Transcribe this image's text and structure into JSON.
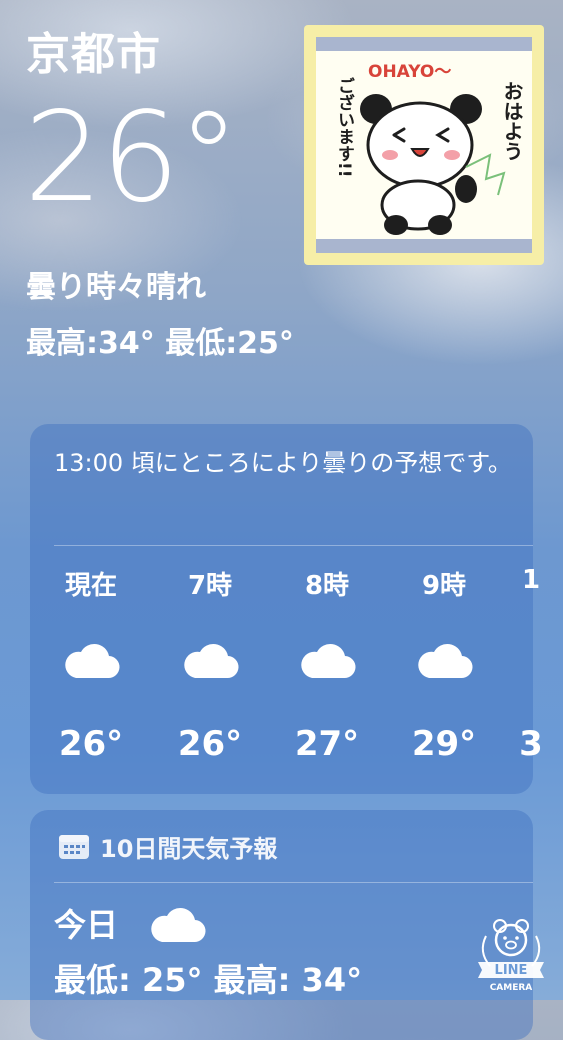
{
  "header": {
    "city": "京都市",
    "temperature": "26°",
    "condition": "曇り時々晴れ",
    "high_low": "最高:34°  最低:25°"
  },
  "sticker": {
    "banner": "OHAYO〜",
    "greeting_line1": "おはよう",
    "greeting_line2": "ございます!!",
    "icon": "panda-sticker-icon"
  },
  "hourly": {
    "summary": "13:00 頃にところにより曇りの予想です。",
    "items": [
      {
        "time": "現在",
        "icon": "cloud-icon",
        "temp": "26°"
      },
      {
        "time": "7時",
        "icon": "cloud-icon",
        "temp": "26°"
      },
      {
        "time": "8時",
        "icon": "cloud-icon",
        "temp": "27°"
      },
      {
        "time": "9時",
        "icon": "cloud-icon",
        "temp": "29°"
      },
      {
        "time": "1",
        "icon": "",
        "temp": "3"
      }
    ]
  },
  "daily": {
    "title": "10日間天気予報",
    "icon": "calendar-icon",
    "today_label": "今日",
    "today_icon": "cloud-icon",
    "today_low_high": "最低: 25°  最高: 34°"
  },
  "watermark": {
    "line1": "LINE",
    "line2": "CAMERA",
    "icon": "line-camera-bear-icon"
  },
  "colors": {
    "sky_top": "#a9b3c4",
    "sky_bottom": "#6b9ad6",
    "card": "#3c6ebe",
    "sticker_frame": "#f6eea7"
  }
}
